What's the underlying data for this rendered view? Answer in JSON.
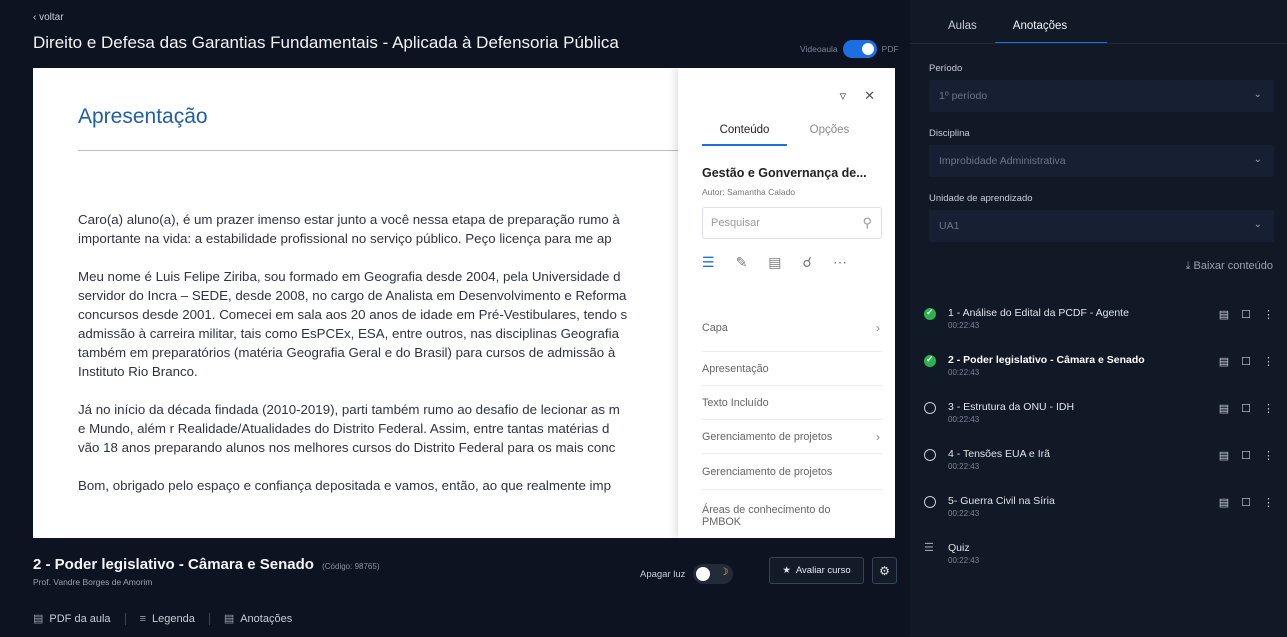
{
  "header": {
    "back_label": "voltar",
    "course_title": "Direito e Defesa das Garantias Fundamentais - Aplicada à Defensoria Pública",
    "toggle_left": "Videoaula",
    "toggle_right": "PDF"
  },
  "document": {
    "heading": "Apresentação",
    "paragraphs": [
      [
        "Caro(a) aluno(a), é um prazer imenso estar junto a você nessa etapa de preparação rumo à",
        "importante na vida: a estabilidade profissional no serviço público. Peço licença para me ap"
      ],
      [
        "Meu nome é Luis Felipe Ziriba,  sou formado em Geografia desde 2004, pela Universidade d",
        "servidor do Incra – SEDE, desde 2008, no cargo de Analista em Desenvolvimento e Reforma",
        "concursos desde 2001. Comecei em sala aos 20 anos de idade em Pré-Vestibulares, tendo s",
        "admissão à carreira militar, tais como EsPCEx, ESA, entre outros, nas disciplinas Geografia",
        "também em preparatórios (matéria Geografia Geral e do Brasil) para cursos de admissão à",
        "Instituto Rio Branco."
      ],
      [
        "Já no início da década findada (2010-2019), parti também rumo ao desafio de lecionar as m",
        "e Mundo, além r Realidade/Atualidades do Distrito Federal. Assim, entre tantas matérias d",
        "vão 18 anos preparando alunos nos melhores cursos do Distrito Federal para os mais conc"
      ],
      [
        "Bom, obrigado pelo espaço e confiança depositada e vamos, então, ao que realmente imp"
      ]
    ]
  },
  "pdf_panel": {
    "tabs": [
      "Conteúdo",
      "Opções"
    ],
    "active_tab": 0,
    "book_title": "Gestão e Gonvernança de...",
    "author": "Autor: Samantha Calado",
    "search_placeholder": "Pesquisar",
    "toc": [
      {
        "label": "Capa",
        "chevron": true
      },
      {
        "label": "Apresentação",
        "chevron": false
      },
      {
        "label": "Texto Incluído",
        "chevron": false
      },
      {
        "label": "Gerenciamento de projetos",
        "chevron": true
      },
      {
        "label": "Gerenciamento de projetos",
        "chevron": false
      },
      {
        "label": "Áreas de conhecimento do PMBOK",
        "chevron": false
      }
    ]
  },
  "lesson": {
    "title": "2 - Poder legislativo - Câmara e Senado",
    "code": "(Código: 98765)",
    "professor": "Prof. Vandre Borges de Amorim",
    "lights_label": "Apagar luz",
    "rate_label": "Avaliar curso"
  },
  "bottom_links": [
    "PDF da aula",
    "Legenda",
    "Anotações"
  ],
  "sidebar": {
    "tabs": [
      "Aulas",
      "Anotações"
    ],
    "active_tab": 1,
    "period_label": "Período",
    "period_value": "1º período",
    "discipline_label": "Disciplina",
    "discipline_value": "Improbidade Administrativa",
    "unit_label": "Unidade de aprendizado",
    "unit_value": "UA1",
    "download_label": "Baixar conteúdo",
    "lessons": [
      {
        "title": "1 - Análise do Edital da PCDF - Agente",
        "duration": "00:22:43",
        "status": "done",
        "bold": false
      },
      {
        "title": "2 - Poder legislativo - Câmara e Senado",
        "duration": "00:22:43",
        "status": "done",
        "bold": true
      },
      {
        "title": "3 - Estrutura da ONU - IDH",
        "duration": "00:22:43",
        "status": "open",
        "bold": false
      },
      {
        "title": "4 - Tensões EUA e Irã",
        "duration": "00:22:43",
        "status": "open",
        "bold": false
      },
      {
        "title": "5- Guerra Civil na Síria",
        "duration": "00:22:43",
        "status": "open",
        "bold": false
      },
      {
        "title": "Quiz",
        "duration": "00:22:43",
        "status": "quiz",
        "bold": false
      }
    ]
  }
}
